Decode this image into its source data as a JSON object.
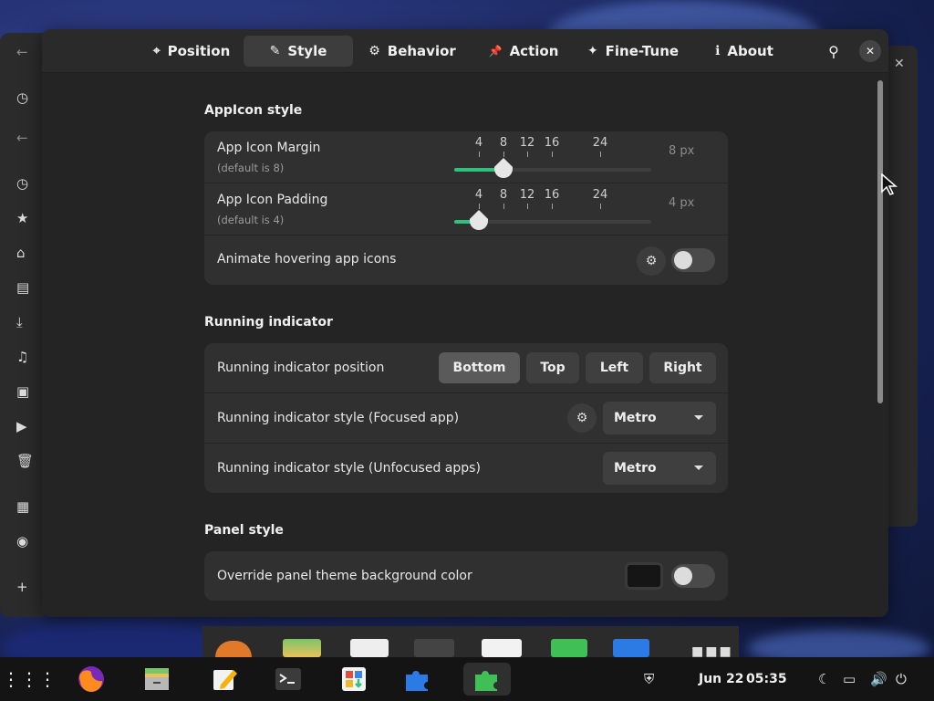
{
  "tabs": [
    {
      "label": "Position",
      "icon": "crosshair-icon",
      "glyph": "⌖"
    },
    {
      "label": "Style",
      "icon": "brush-icon",
      "glyph": "✎"
    },
    {
      "label": "Behavior",
      "icon": "gear-icon",
      "glyph": "⚙"
    },
    {
      "label": "Action",
      "icon": "pin-icon",
      "glyph": "📌"
    },
    {
      "label": "Fine-Tune",
      "icon": "puzzle-icon",
      "glyph": "✦"
    },
    {
      "label": "About",
      "icon": "info-icon",
      "glyph": "ℹ"
    }
  ],
  "active_tab": "Style",
  "header": {
    "search_glyph": "⚲",
    "close_glyph": "✕"
  },
  "appicon": {
    "title": "AppIcon style",
    "margin": {
      "label": "App Icon Margin",
      "sub": "(default is 8)",
      "value_text": "8 px",
      "value": 8
    },
    "padding": {
      "label": "App Icon Padding",
      "sub": "(default is 4)",
      "value_text": "4 px",
      "value": 4
    },
    "ticks": [
      "4",
      "8",
      "12",
      "16",
      "24"
    ],
    "animate": {
      "label": "Animate hovering app icons",
      "enabled": false
    }
  },
  "running": {
    "title": "Running indicator",
    "position": {
      "label": "Running indicator position",
      "options": [
        "Bottom",
        "Top",
        "Left",
        "Right"
      ],
      "selected": "Bottom"
    },
    "focused": {
      "label": "Running indicator style (Focused app)",
      "value": "Metro"
    },
    "unfocused": {
      "label": "Running indicator style (Unfocused apps)",
      "value": "Metro"
    }
  },
  "panel_style": {
    "title": "Panel style",
    "override": {
      "label": "Override panel theme background color",
      "enabled": false,
      "color": "#151515"
    }
  },
  "topbar": {
    "date": "Jun 22",
    "time": "05:35"
  },
  "colors": {
    "accent": "#2ec27e",
    "dialog_bg": "#242424",
    "row_bg": "#303030"
  }
}
